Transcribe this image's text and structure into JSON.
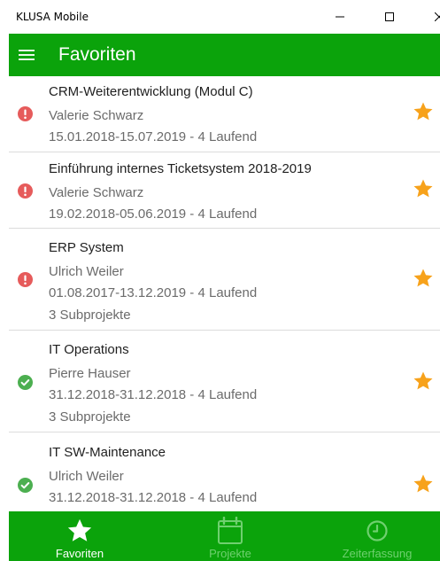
{
  "window": {
    "title": "KLUSA Mobile"
  },
  "appbar": {
    "title": "Favoriten",
    "menu_icon": "hamburger-icon"
  },
  "colors": {
    "brand_green": "#0ba30b",
    "warning_red": "#e65b5b",
    "ok_green": "#4caf50",
    "star_orange": "#f7a21b"
  },
  "projects": [
    {
      "name": "CRM-Weiterentwicklung (Modul C)",
      "manager": "Valerie Schwarz",
      "period": "15.01.2018-15.07.2019 - 4 Laufend",
      "subprojects": "",
      "status": "warning",
      "favorite": true
    },
    {
      "name": "Einführung internes Ticketsystem 2018-2019",
      "manager": "Valerie Schwarz",
      "period": "19.02.2018-05.06.2019 - 4 Laufend",
      "subprojects": "",
      "status": "warning",
      "favorite": true
    },
    {
      "name": "ERP System",
      "manager": "Ulrich Weiler",
      "period": "01.08.2017-13.12.2019 - 4 Laufend",
      "subprojects": "3 Subprojekte",
      "status": "warning",
      "favorite": true
    },
    {
      "name": "IT Operations",
      "manager": "Pierre Hauser",
      "period": "31.12.2018-31.12.2018 - 4 Laufend",
      "subprojects": "3 Subprojekte",
      "status": "ok",
      "favorite": true
    },
    {
      "name": "IT SW-Maintenance",
      "manager": "Ulrich Weiler",
      "period": "31.12.2018-31.12.2018 - 4 Laufend",
      "subprojects": "",
      "status": "ok",
      "favorite": true
    }
  ],
  "tabs": [
    {
      "label": "Favoriten",
      "icon": "star-icon",
      "active": true
    },
    {
      "label": "Projekte",
      "icon": "calendar-icon",
      "active": false
    },
    {
      "label": "Zeiterfassung",
      "icon": "clock-icon",
      "active": false
    }
  ]
}
